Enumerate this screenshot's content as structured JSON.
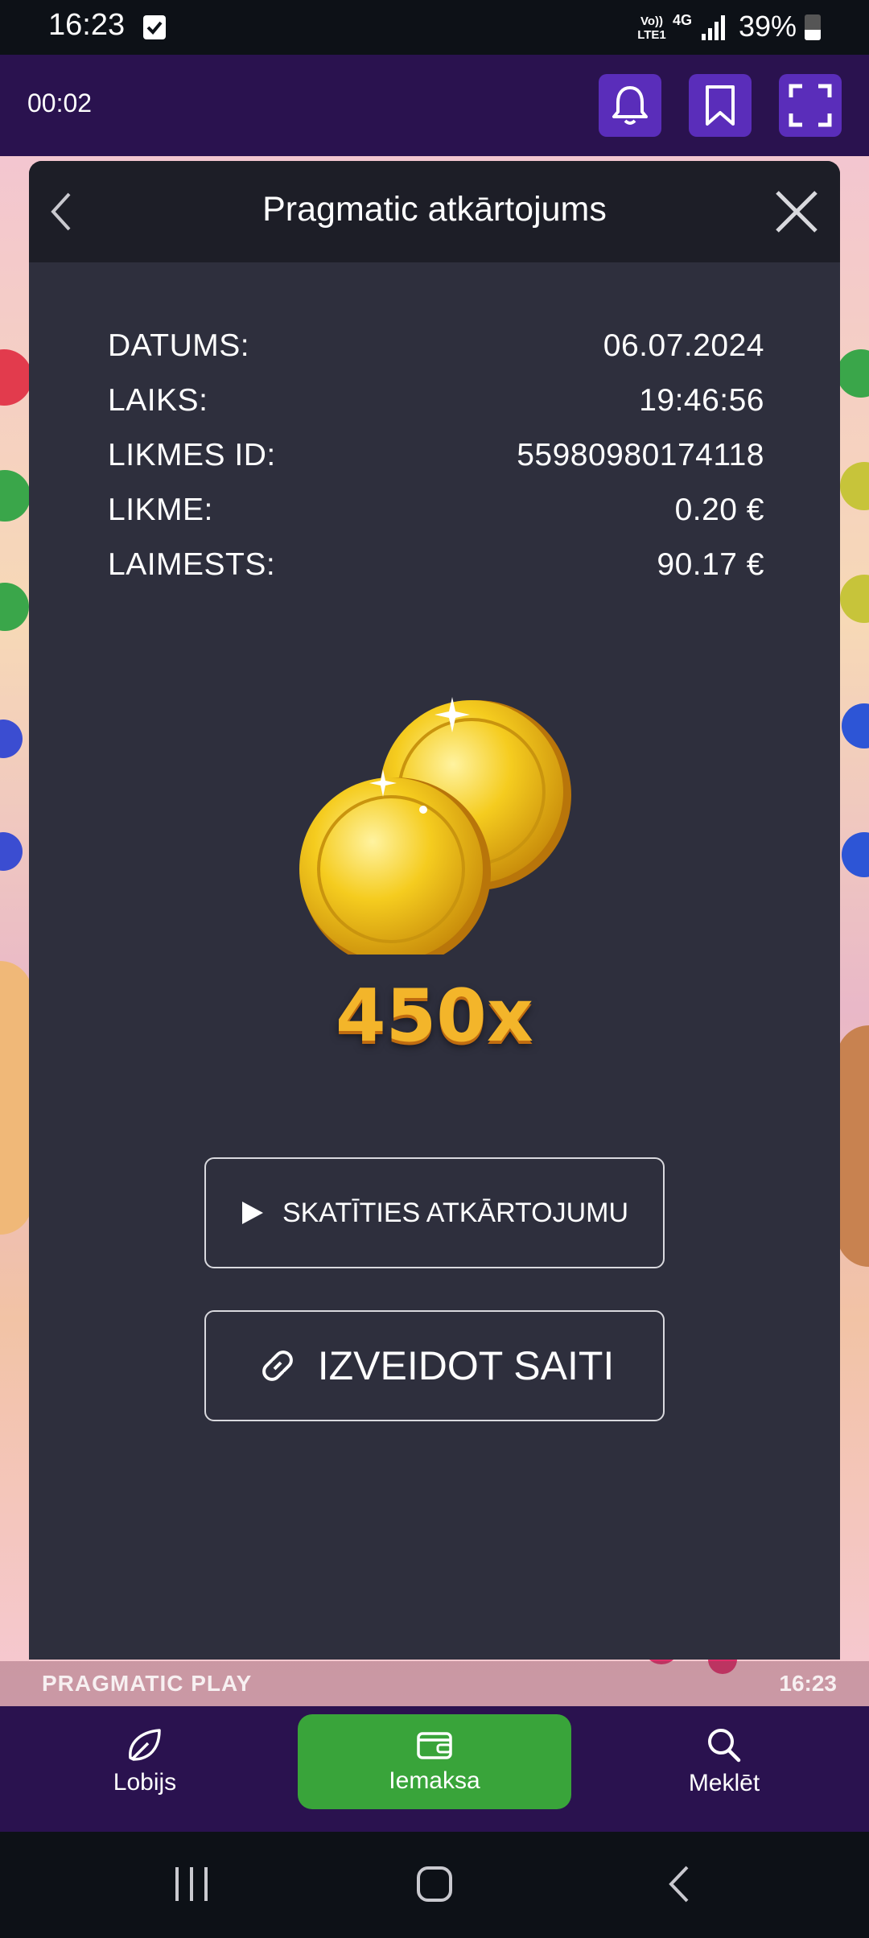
{
  "status_bar": {
    "time": "16:23",
    "volte": "Vo)) LTE1",
    "network": "4G",
    "battery": "39%"
  },
  "top_bar": {
    "timer": "00:02"
  },
  "modal": {
    "title": "Pragmatic atkārtojums",
    "rows": [
      {
        "label": "DATUMS:",
        "value": "06.07.2024"
      },
      {
        "label": "LAIKS:",
        "value": "19:46:56"
      },
      {
        "label": "LIKMES ID:",
        "value": "55980980174118"
      },
      {
        "label": "LIKME:",
        "value": "0.20 €"
      },
      {
        "label": "LAIMESTS:",
        "value": "90.17 €"
      }
    ],
    "multiplier": "450x",
    "watch_button": "SKATĪTIES ATKĀRTOJUMU",
    "link_button": "IZVEIDOT SAITI"
  },
  "game_background": {
    "brand": "PRAGMATIC PLAY",
    "clock": "16:23"
  },
  "bottom_nav": [
    {
      "label": "Lobijs",
      "icon": "leaf-icon"
    },
    {
      "label": "Iemaksa",
      "icon": "wallet-icon",
      "active": true
    },
    {
      "label": "Meklēt",
      "icon": "search-icon"
    }
  ],
  "colors": {
    "topbar": "#2a124f",
    "accent_button": "#5a2dba",
    "active_nav": "#39a43a",
    "modal_bg": "#2e2f3d",
    "modal_header": "#1d1e27"
  }
}
